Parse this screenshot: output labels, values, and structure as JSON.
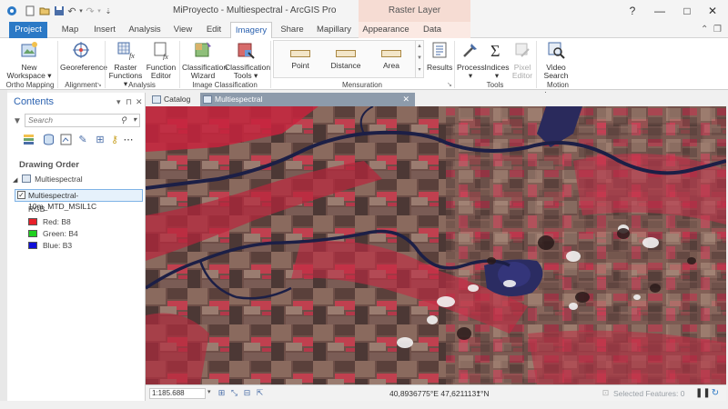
{
  "window": {
    "title": "MiProyecto - Multiespectral - ArcGIS Pro",
    "context_label": "Raster Layer",
    "help": "?",
    "minimize": "—",
    "maximize": "□",
    "close": "✕"
  },
  "tabs": [
    "Project",
    "Map",
    "Insert",
    "Analysis",
    "View",
    "Edit",
    "Imagery",
    "Share",
    "Mapillary",
    "Appearance",
    "Data"
  ],
  "ribbon_controls": {
    "sign_in": "⌃",
    "pin": "❐"
  },
  "ribbon": {
    "buttons": {
      "new_workspace": "New\nWorkspace ▾",
      "georeference": "Georeference",
      "raster_functions": "Raster\nFunctions ▾",
      "function_editor": "Function\nEditor",
      "classification_wizard": "Classification\nWizard",
      "classification_tools": "Classification\nTools ▾",
      "results": "Results",
      "process": "Process\n▾",
      "indices": "Indices\n▾",
      "pixel_editor": "Pixel\nEditor",
      "video_search": "Video\nSearch"
    },
    "mensuration": {
      "point": "Point",
      "distance": "Distance",
      "area": "Area"
    },
    "groups": {
      "ortho_mapping": "Ortho Mapping",
      "alignment": "Alignment",
      "analysis": "Analysis",
      "image_classification": "Image Classification",
      "mensuration": "Mensuration",
      "tools": "Tools",
      "motion_imagery": "Motion Imagery"
    }
  },
  "contents": {
    "title": "Contents",
    "search_placeholder": "Search",
    "drawing_order": "Drawing Order",
    "map_name": "Multiespectral",
    "layer_name": "Multiespectral-10m_MTD_MSIL1C",
    "renderer": "RGB",
    "bands": [
      {
        "label": "Red:  B8",
        "color": "#e8202a"
      },
      {
        "label": "Green: B4",
        "color": "#1fd11f"
      },
      {
        "label": "Blue:  B3",
        "color": "#1010d8"
      }
    ]
  },
  "view_tabs": {
    "catalog": "Catalog",
    "map": "Multiespectral"
  },
  "status": {
    "scale": "1:185.688",
    "coordinates": "40,8936775°E 47,6211131°N",
    "selected_features": "Selected Features: 0"
  }
}
